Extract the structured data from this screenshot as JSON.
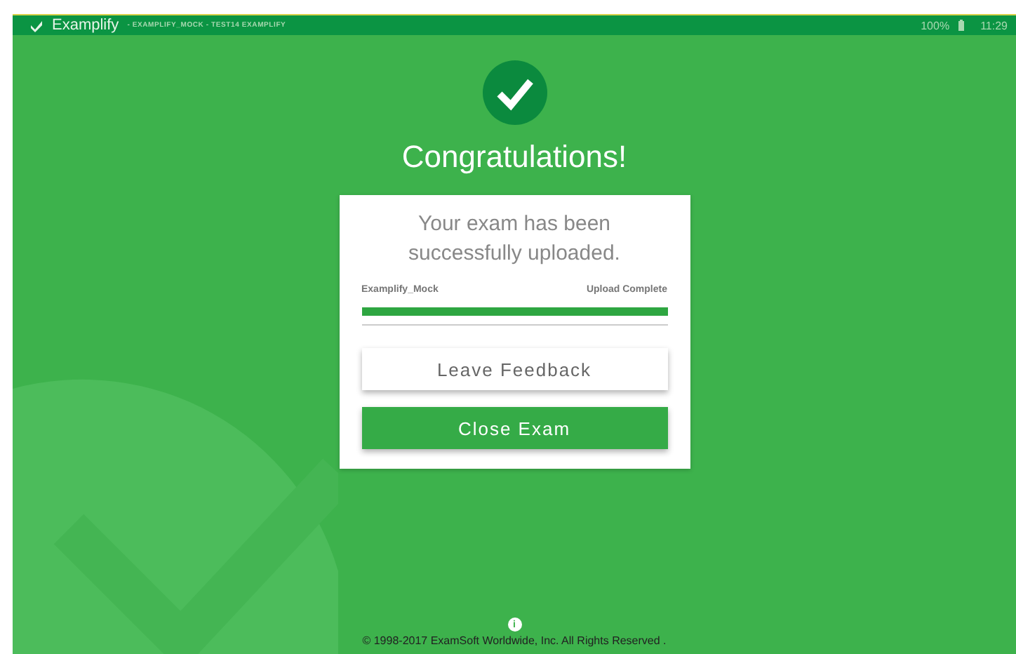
{
  "top_bar": {
    "app_name": "Examplify",
    "exam_title": "- EXAMPLIFY_MOCK - TEST14 EXAMPLIFY",
    "battery": "100%",
    "time": "11:29"
  },
  "heading": "Congratulations!",
  "card": {
    "message": "Your exam has been successfully uploaded.",
    "exam_name": "Examplify_Mock",
    "upload_status": "Upload Complete",
    "upload": {
      "level": 1
    },
    "buttons": [
      {
        "label": "Leave Feedback",
        "kind": "secondary"
      },
      {
        "label": "Close Exam",
        "kind": "primary"
      }
    ]
  },
  "footer": {
    "info_icon": "i",
    "copyright": "© 1998-2017 ExamSoft Worldwide, Inc. All Rights Reserved ."
  }
}
